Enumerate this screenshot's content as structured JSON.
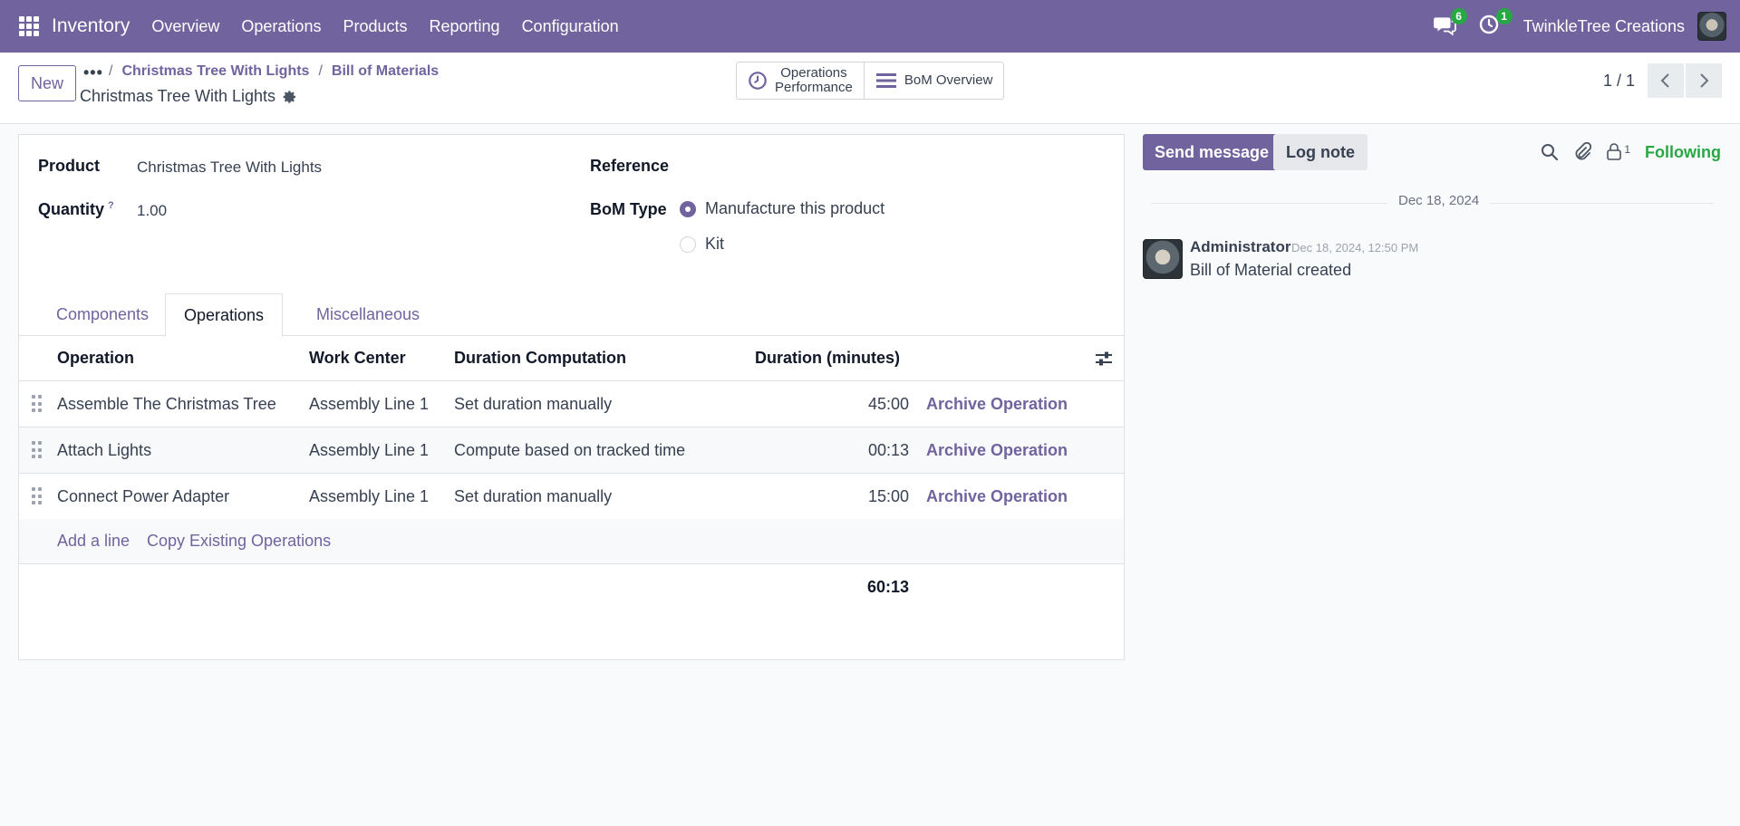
{
  "navbar": {
    "app_name": "Inventory",
    "menu": [
      "Overview",
      "Operations",
      "Products",
      "Reporting",
      "Configuration"
    ],
    "messages_count": "6",
    "activities_count": "1",
    "company": "TwinkleTree Creations"
  },
  "control": {
    "new_label": "New",
    "more_label": "•••",
    "breadcrumbs": [
      "Christmas Tree With Lights",
      "Bill of Materials"
    ],
    "record_title": "Christmas Tree With Lights",
    "smart_buttons": {
      "ops_perf_line1": "Operations",
      "ops_perf_line2": "Performance",
      "bom_overview": "BoM Overview"
    },
    "pager": "1 / 1"
  },
  "form": {
    "product_label": "Product",
    "product_value": "Christmas Tree With Lights",
    "quantity_label": "Quantity",
    "quantity_help": "?",
    "quantity_value": "1.00",
    "reference_label": "Reference",
    "bom_type_label": "BoM Type",
    "bom_type_options": [
      "Manufacture this product",
      "Kit"
    ],
    "bom_type_selected": "Manufacture this product"
  },
  "tabs": [
    "Components",
    "Operations",
    "Miscellaneous"
  ],
  "active_tab": "Operations",
  "table": {
    "headers": [
      "Operation",
      "Work Center",
      "Duration Computation",
      "Duration (minutes)"
    ],
    "rows": [
      {
        "operation": "Assemble The Christmas Tree",
        "work_center": "Assembly Line 1",
        "computation": "Set duration manually",
        "duration": "45:00",
        "action": "Archive Operation"
      },
      {
        "operation": "Attach Lights",
        "work_center": "Assembly Line 1",
        "computation": "Compute based on tracked time",
        "duration": "00:13",
        "action": "Archive Operation"
      },
      {
        "operation": "Connect Power Adapter",
        "work_center": "Assembly Line 1",
        "computation": "Set duration manually",
        "duration": "15:00",
        "action": "Archive Operation"
      }
    ],
    "add_line": "Add a line",
    "copy_existing": "Copy Existing Operations",
    "total_duration": "60:13"
  },
  "chatter": {
    "send_message": "Send message",
    "log_note": "Log note",
    "followers_count": "1",
    "following": "Following",
    "date_separator": "Dec 18, 2024",
    "message": {
      "author": "Administrator",
      "date": "Dec 18, 2024, 12:50 PM",
      "body": "Bill of Material created"
    }
  },
  "colors": {
    "brand": "#71639e",
    "following": "#28a745"
  }
}
